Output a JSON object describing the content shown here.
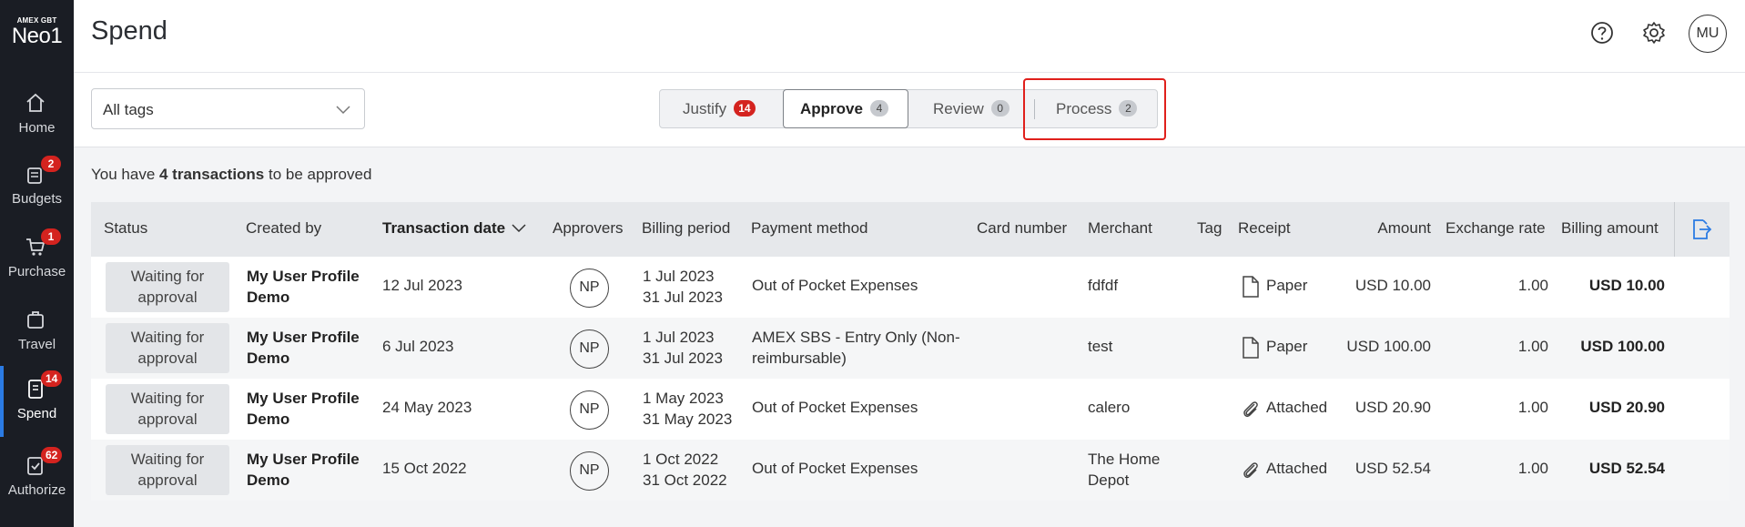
{
  "brand": {
    "top": "AMEX GBT",
    "name": "Neo1"
  },
  "nav": [
    {
      "label": "Home",
      "icon": "home-icon",
      "badge": ""
    },
    {
      "label": "Budgets",
      "icon": "budgets-icon",
      "badge": "2"
    },
    {
      "label": "Purchase",
      "icon": "cart-icon",
      "badge": "1"
    },
    {
      "label": "Travel",
      "icon": "suitcase-icon",
      "badge": ""
    },
    {
      "label": "Spend",
      "icon": "receipt-icon",
      "badge": "14",
      "active": true
    },
    {
      "label": "Authorize",
      "icon": "clipboard-check-icon",
      "badge": "62"
    }
  ],
  "header": {
    "title": "Spend",
    "avatar": "MU"
  },
  "filter": {
    "tags_value": "All tags"
  },
  "tabs": [
    {
      "label": "Justify",
      "count": "14"
    },
    {
      "label": "Approve",
      "count": "4"
    },
    {
      "label": "Review",
      "count": "0"
    },
    {
      "label": "Process",
      "count": "2"
    }
  ],
  "summary": {
    "prefix": "You have ",
    "count": "4 transactions",
    "suffix": " to be approved"
  },
  "columns": {
    "status": "Status",
    "created_by": "Created by",
    "transaction_date": "Transaction date",
    "approvers": "Approvers",
    "billing_period": "Billing period",
    "payment_method": "Payment method",
    "card_number": "Card number",
    "merchant": "Merchant",
    "tag": "Tag",
    "receipt": "Receipt",
    "amount": "Amount",
    "exchange_rate": "Exchange rate",
    "billing_amount": "Billing amount"
  },
  "rows": [
    {
      "status_1": "Waiting for",
      "status_2": "approval",
      "created_1": "My User Profile",
      "created_2": "Demo",
      "date": "12 Jul 2023",
      "approver": "NP",
      "period_1": "1 Jul 2023",
      "period_2": "31 Jul 2023",
      "payment_1": "Out of Pocket Expenses",
      "payment_2": "",
      "merchant_1": "fdfdf",
      "merchant_2": "",
      "receipt": "Paper",
      "receipt_icon": "document-icon",
      "amount": "USD 10.00",
      "rate": "1.00",
      "billing": "USD 10.00"
    },
    {
      "status_1": "Waiting for",
      "status_2": "approval",
      "created_1": "My User Profile",
      "created_2": "Demo",
      "date": "6 Jul 2023",
      "approver": "NP",
      "period_1": "1 Jul 2023",
      "period_2": "31 Jul 2023",
      "payment_1": "AMEX SBS - Entry Only (Non-",
      "payment_2": "reimbursable)",
      "merchant_1": "test",
      "merchant_2": "",
      "receipt": "Paper",
      "receipt_icon": "document-icon",
      "amount": "USD 100.00",
      "rate": "1.00",
      "billing": "USD 100.00"
    },
    {
      "status_1": "Waiting for",
      "status_2": "approval",
      "created_1": "My User Profile",
      "created_2": "Demo",
      "date": "24 May 2023",
      "approver": "NP",
      "period_1": "1 May 2023",
      "period_2": "31 May 2023",
      "payment_1": "Out of Pocket Expenses",
      "payment_2": "",
      "merchant_1": "calero",
      "merchant_2": "",
      "receipt": "Attached",
      "receipt_icon": "paperclip-icon",
      "amount": "USD 20.90",
      "rate": "1.00",
      "billing": "USD 20.90"
    },
    {
      "status_1": "Waiting for",
      "status_2": "approval",
      "created_1": "My User Profile",
      "created_2": "Demo",
      "date": "15 Oct 2022",
      "approver": "NP",
      "period_1": "1 Oct 2022",
      "period_2": "31 Oct 2022",
      "payment_1": "Out of Pocket Expenses",
      "payment_2": "",
      "merchant_1": "The Home",
      "merchant_2": "Depot",
      "receipt": "Attached",
      "receipt_icon": "paperclip-icon",
      "amount": "USD 52.54",
      "rate": "1.00",
      "billing": "USD 52.54"
    }
  ],
  "colors": {
    "sidebar": "#1a1d24",
    "badge": "#d4231f",
    "accent": "#2b7be4",
    "highlight": "#e0201c"
  }
}
